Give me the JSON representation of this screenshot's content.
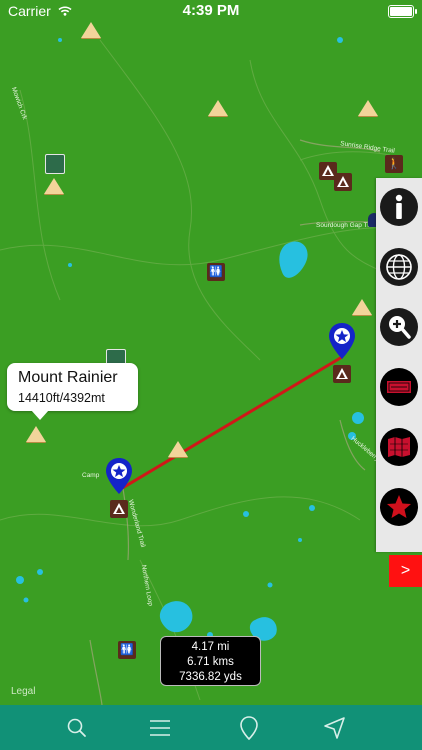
{
  "status_bar": {
    "carrier": "Carrier",
    "time": "4:39 PM"
  },
  "callout": {
    "title": "Mount Rainier",
    "subtitle": "14410ft/4392mt"
  },
  "distance": {
    "miles": "4.17 mi",
    "kms": "6.71 kms",
    "yards": "7336.82 yds"
  },
  "legal": "Legal",
  "collapse_label": ">",
  "map_labels": {
    "road_ne": "Sunrise Ridge Trail",
    "road_east": "Sourdough Gap Trail",
    "trail_right": "Huckleberry Trail",
    "camp_label": "Camp",
    "trail_mid": "Wonderland Trail",
    "trail_lower": "Northern Loop",
    "left_creek": "Mowich Crk"
  },
  "toolbar_icons": [
    "info-icon",
    "globe-icon",
    "zoom-in-icon",
    "trail-sign-icon",
    "map-icon",
    "star-icon"
  ],
  "tab_icons": [
    "search-icon",
    "menu-icon",
    "location-pin-icon",
    "navigate-arrow-icon"
  ],
  "colors": {
    "map_green": "#3b9e23",
    "route_red": "#d01818",
    "pin_blue": "#1424c8",
    "tab_teal": "#119177",
    "collapse_red": "#ff1111"
  }
}
